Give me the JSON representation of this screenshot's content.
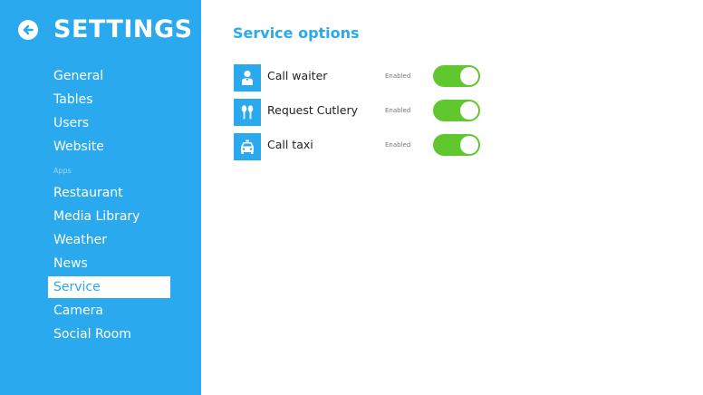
{
  "sidebar": {
    "title": "SETTINGS",
    "back_icon": "arrow-left-icon",
    "items_top": [
      {
        "label": "General"
      },
      {
        "label": "Tables"
      },
      {
        "label": "Users"
      },
      {
        "label": "Website"
      }
    ],
    "section_label": "Apps",
    "items_apps": [
      {
        "label": "Restaurant"
      },
      {
        "label": "Media Library"
      },
      {
        "label": "Weather"
      },
      {
        "label": "News"
      },
      {
        "label": "Service",
        "active": true
      },
      {
        "label": "Camera"
      },
      {
        "label": "Social Room"
      }
    ]
  },
  "main": {
    "title": "Service options",
    "options": [
      {
        "label": "Call waiter",
        "icon": "waiter-icon",
        "status": "Enabled",
        "enabled": true
      },
      {
        "label": "Request Cutlery",
        "icon": "cutlery-icon",
        "status": "Enabled",
        "enabled": true
      },
      {
        "label": "Call taxi",
        "icon": "taxi-icon",
        "status": "Enabled",
        "enabled": true
      }
    ]
  },
  "colors": {
    "accent": "#2aa9ee",
    "toggle_on": "#61c72f",
    "background": "#ffffff"
  }
}
